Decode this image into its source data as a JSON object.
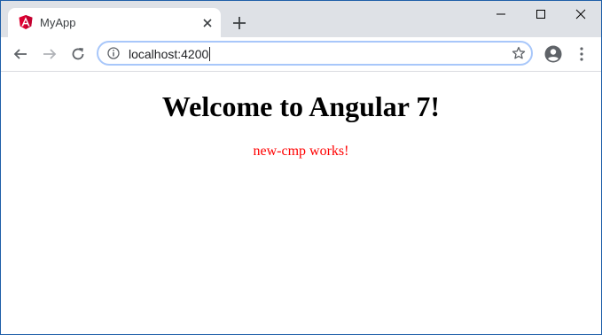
{
  "browser": {
    "tab": {
      "title": "MyApp",
      "favicon": "angular-shield-icon"
    },
    "address_bar": {
      "url": "localhost:4200",
      "security_icon": "info-icon"
    },
    "toolbar_icons": [
      "back-arrow-icon",
      "forward-arrow-icon",
      "reload-icon",
      "star-icon",
      "profile-icon",
      "kebab-menu-icon"
    ],
    "window_controls": [
      "minimize-icon",
      "maximize-icon",
      "close-icon"
    ]
  },
  "page": {
    "heading": "Welcome to Angular 7!",
    "component_text": "new-cmp works!"
  },
  "colors": {
    "titlebar": "#dee1e6",
    "angular_red": "#dd0031",
    "component_text": "#ff0000",
    "omnibox_focus": "#a8c7fa"
  }
}
